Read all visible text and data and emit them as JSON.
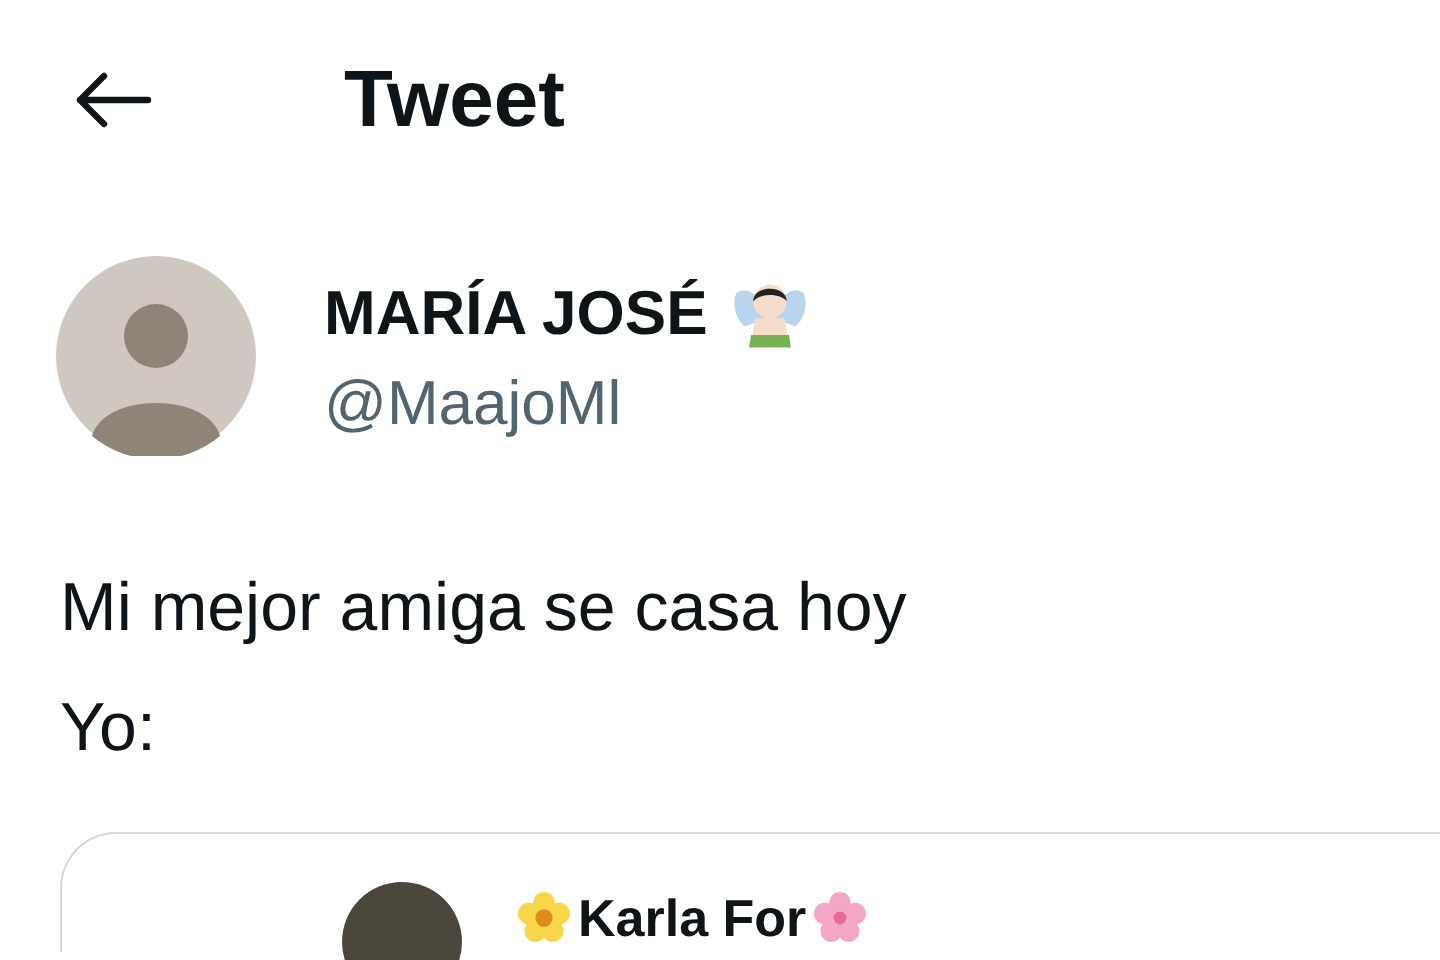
{
  "header": {
    "title": "Tweet"
  },
  "author": {
    "name": "MARÍA JOSÉ",
    "handle": "@MaajoMl"
  },
  "tweet": {
    "lines": [
      "Mi mejor amiga se casa hoy",
      "Yo:"
    ]
  },
  "quoted_tweet": {
    "name": "Karla For"
  }
}
